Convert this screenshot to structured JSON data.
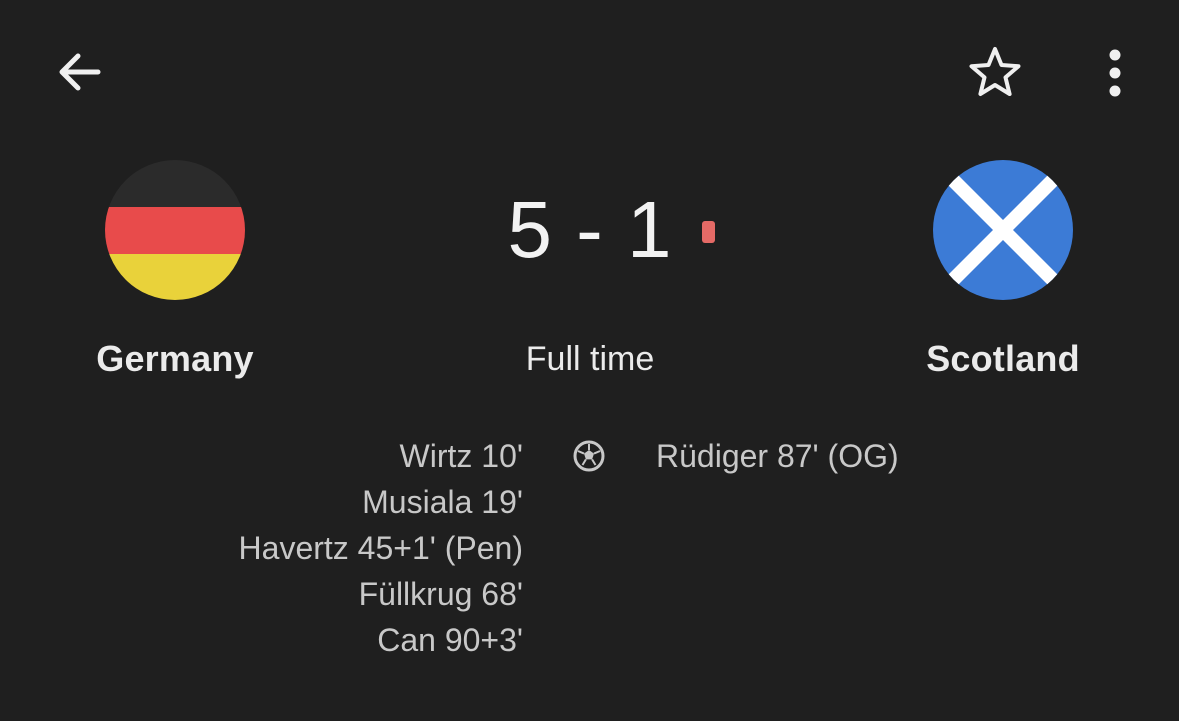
{
  "header": {
    "back_icon": "arrow-left-icon",
    "favorite_icon": "star-outline-icon",
    "more_icon": "more-vertical-icon"
  },
  "match": {
    "home_team": "Germany",
    "away_team": "Scotland",
    "score": "5 - 1",
    "status": "Full time",
    "goal_icon": "soccer-ball-icon",
    "home_scorers": [
      "Wirtz 10'",
      "Musiala 19'",
      "Havertz 45+1' (Pen)",
      "Füllkrug 68'",
      "Can 90+3'"
    ],
    "away_scorers": [
      "Rüdiger 87' (OG)"
    ]
  },
  "colors": {
    "background": "#1f1f1f",
    "text_primary": "#ebebeb",
    "text_secondary": "#c8c8c8",
    "live_indicator": "#e56a66",
    "germany_black": "#2b2b2b",
    "germany_red": "#e84b4b",
    "germany_gold": "#e9d23a",
    "scotland_blue": "#3c7bd6",
    "scotland_white": "#ffffff"
  }
}
